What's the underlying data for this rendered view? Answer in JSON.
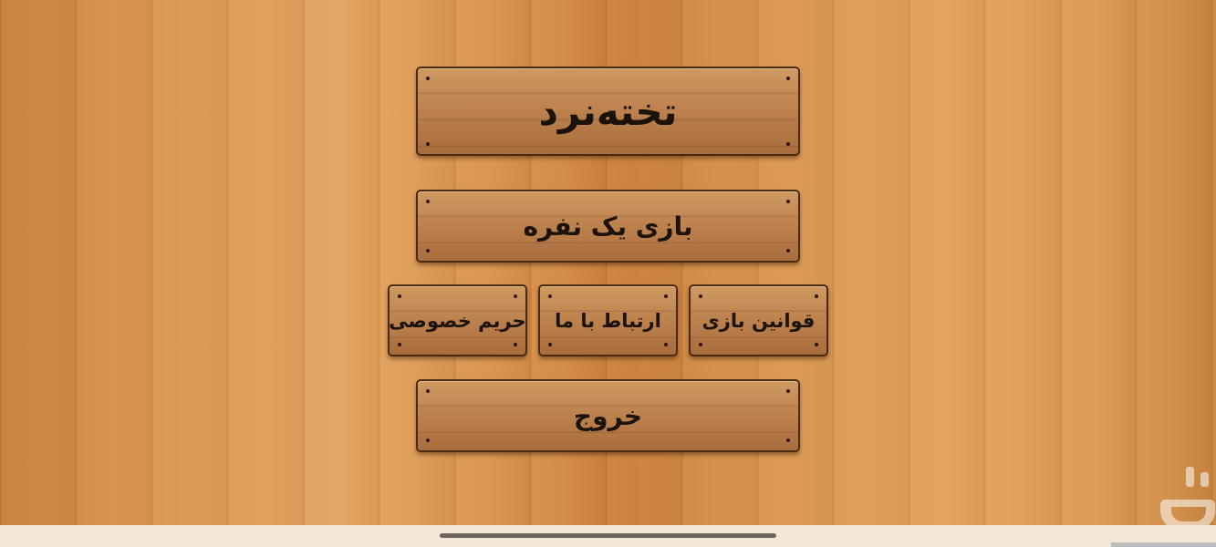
{
  "menu": {
    "title": "تخته‌نرد",
    "single_player": "بازی یک نفره",
    "privacy": "حریم خصوصی",
    "contact_us": "ارتباط با ما",
    "game_rules": "قوانین بازی",
    "exit": "خروج"
  },
  "icons": {
    "watermark": "bazaar-logo-icon"
  },
  "colors": {
    "wood_background": "#d9954e",
    "plank": "#b97e4a",
    "plank_border": "#4a2a12",
    "text": "#1b1209",
    "bottom_bar": "#f4e7d7"
  }
}
